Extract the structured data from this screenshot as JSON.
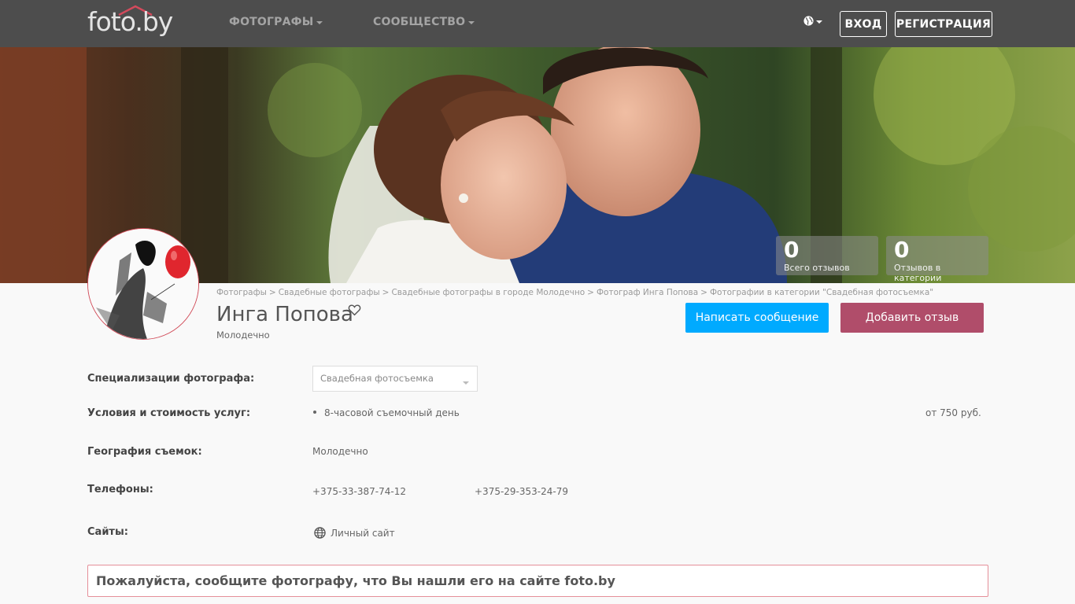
{
  "nav": {
    "logo": "foto.by",
    "menu": [
      {
        "label": "ФОТОГРАФЫ"
      },
      {
        "label": "СООБЩЕСТВО"
      }
    ],
    "login": "ВХОД",
    "register": "РЕГИСТРАЦИЯ"
  },
  "stats": [
    {
      "value": "0",
      "label": "Всего отзывов"
    },
    {
      "value": "0",
      "label": "Отзывов в категории"
    }
  ],
  "breadcrumb": [
    "Фотографы",
    "Свадебные фотографы",
    "Свадебные фотографы в городе Молодечно",
    "Фотограф Инга Попова",
    "Фотографии в категории \"Свадебная фотосъемка\""
  ],
  "profile": {
    "name": "Инга Попова",
    "city": "Молодечно",
    "message_button": "Написать сообщение",
    "review_button": "Добавить отзыв"
  },
  "info": {
    "specializations_label": "Специализации фотографа:",
    "specialization_selected": "Свадебная фотосъемка",
    "services_label": "Условия и стоимость услуг:",
    "service_name": "8-часовой съемочный день",
    "service_price": "от 750 руб.",
    "geo_label": "География съемок:",
    "geo_value": "Молодечно",
    "phones_label": "Телефоны:",
    "phone_1": "+375-33-387-74-12",
    "phone_2": "+375-29-353-24-79",
    "sites_label": "Сайты:",
    "site_link": "Личный сайт"
  },
  "notice": "Пожалуйста, сообщите фотографу, что Вы нашли его на сайте foto.by",
  "colors": {
    "topbar": "#4d4d4d",
    "message_button": "#00aaff",
    "review_button": "#b04d6a",
    "notice_border": "#e58f99"
  }
}
